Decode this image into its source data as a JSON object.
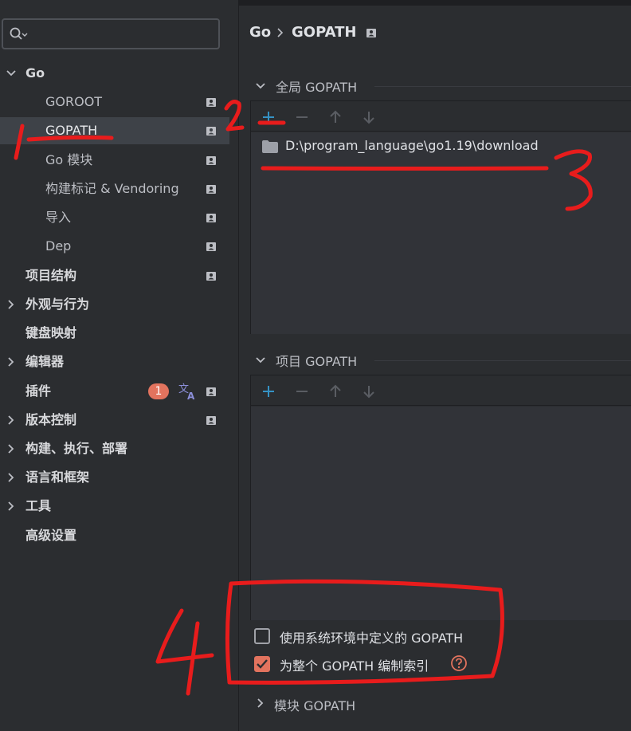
{
  "search": {
    "placeholder": ""
  },
  "sidebar": {
    "items": [
      {
        "label": "Go",
        "level": 0,
        "expanded": true
      },
      {
        "label": "GOROOT",
        "level": 1
      },
      {
        "label": "GOPATH",
        "level": 1,
        "selected": true
      },
      {
        "label": "Go 模块",
        "level": 1
      },
      {
        "label": "构建标记 & Vendoring",
        "level": 1
      },
      {
        "label": "导入",
        "level": 1
      },
      {
        "label": "Dep",
        "level": 1
      },
      {
        "label": "项目结构",
        "level": 0
      },
      {
        "label": "外观与行为",
        "level": 0
      },
      {
        "label": "键盘映射",
        "level": 0
      },
      {
        "label": "编辑器",
        "level": 0
      },
      {
        "label": "插件",
        "level": 0,
        "badge": "1"
      },
      {
        "label": "版本控制",
        "level": 0
      },
      {
        "label": "构建、执行、部署",
        "level": 0
      },
      {
        "label": "语言和框架",
        "level": 0
      },
      {
        "label": "工具",
        "level": 0
      },
      {
        "label": "高级设置",
        "level": 0
      }
    ]
  },
  "breadcrumb": {
    "parent": "Go",
    "current": "GOPATH"
  },
  "global_gopath": {
    "title": "全局 GOPATH",
    "entries": [
      "D:\\program_language\\go1.19\\download"
    ]
  },
  "project_gopath": {
    "title": "项目 GOPATH"
  },
  "options": {
    "use_system_gopath": {
      "label": "使用系统环境中定义的 GOPATH",
      "checked": false
    },
    "index_entire_gopath": {
      "label": "为整个 GOPATH 编制索引",
      "checked": true
    }
  },
  "module_gopath": {
    "title": "模块 GOPATH"
  },
  "annotations": [
    "1",
    "2",
    "3",
    "4"
  ],
  "colors": {
    "accent": "#3592c4",
    "badge": "#e2735e",
    "annotation": "#e81c1c",
    "background": "#2b2d30"
  }
}
